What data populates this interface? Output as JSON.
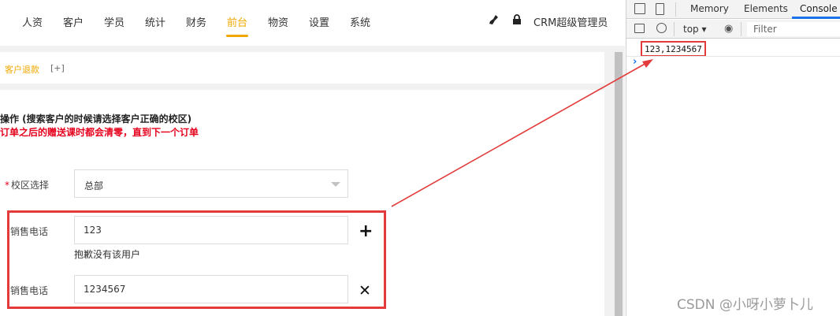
{
  "topnav": {
    "items": [
      {
        "label": "人资"
      },
      {
        "label": "客户"
      },
      {
        "label": "学员"
      },
      {
        "label": "统计"
      },
      {
        "label": "财务"
      },
      {
        "label": "前台"
      },
      {
        "label": "物资"
      },
      {
        "label": "设置"
      },
      {
        "label": "系统"
      }
    ],
    "active_index": 5,
    "user_label": "CRM超级管理员",
    "tool_icons": [
      "broom-icon",
      "lock-icon"
    ]
  },
  "tabs": {
    "active_label": "客户退款",
    "add_label": "[+]"
  },
  "panel": {
    "title": "操作 (搜索客户的时候请选择客户正确的校区)",
    "warning": "订单之后的赠送课时都会清零，直到下一个订单"
  },
  "form": {
    "campus": {
      "required_mark": "*",
      "label": "校区选择",
      "value": "总部"
    },
    "phones": [
      {
        "label": "销售电话",
        "value": "123",
        "hint": "抱歉没有该用户",
        "action_icon": "plus-icon",
        "action_glyph": "+"
      },
      {
        "label": "销售电话",
        "value": "1234567",
        "action_icon": "close-icon",
        "action_glyph": "✕"
      }
    ]
  },
  "devtools": {
    "tabs": [
      "Memory",
      "Elements",
      "Console"
    ],
    "active_tab": "Console",
    "context": "top",
    "filter_placeholder": "Filter",
    "console_output": "123,1234567",
    "prompt": "›"
  },
  "watermark": "CSDN @小呀小萝卜儿",
  "colors": {
    "accent": "#f0a800",
    "warning": "#e6001d",
    "highlight": "#e33b3b",
    "devtools_active": "#1a73e8"
  }
}
